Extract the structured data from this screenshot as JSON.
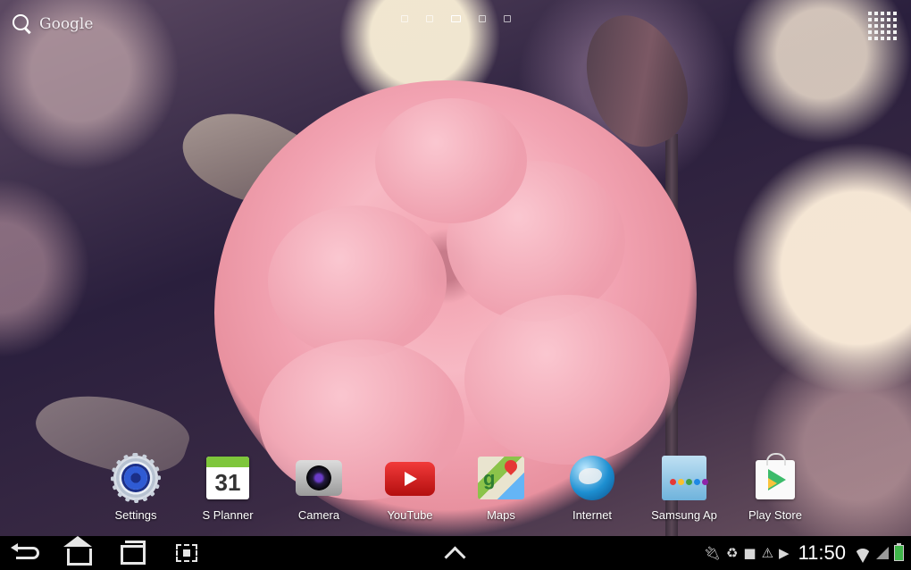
{
  "search": {
    "label": "Google"
  },
  "pages": {
    "count": 5,
    "active": 3
  },
  "dock": {
    "apps": [
      {
        "label": "Settings",
        "icon": "settings-gear-icon"
      },
      {
        "label": "S Planner",
        "icon": "calendar-icon",
        "date": "31"
      },
      {
        "label": "Camera",
        "icon": "camera-icon"
      },
      {
        "label": "YouTube",
        "icon": "youtube-icon"
      },
      {
        "label": "Maps",
        "icon": "maps-icon"
      },
      {
        "label": "Internet",
        "icon": "globe-icon"
      },
      {
        "label": "Samsung Ap",
        "icon": "samsung-apps-icon"
      },
      {
        "label": "Play Store",
        "icon": "play-store-icon"
      }
    ]
  },
  "status_bar": {
    "time": "11:50",
    "icons": [
      "usb-icon",
      "recycle-icon",
      "sd-card-icon",
      "warning-icon",
      "download-icon",
      "wifi-icon",
      "signal-icon",
      "battery-icon"
    ]
  },
  "colors": {
    "navbar_bg": "#000000",
    "rose_pink": "#f4a9b6",
    "youtube_red": "#e62117",
    "play_green": "#3dbb6b"
  }
}
